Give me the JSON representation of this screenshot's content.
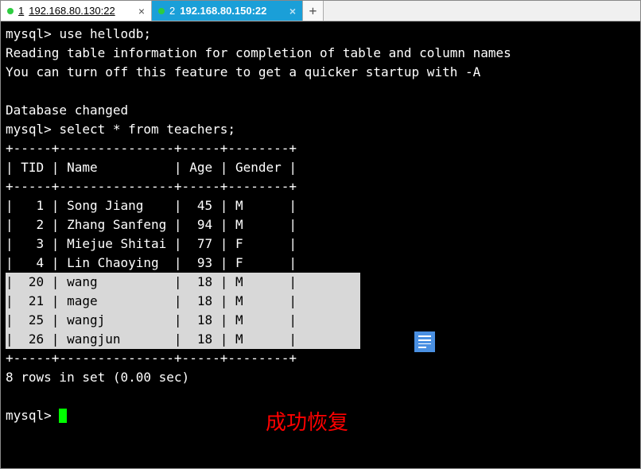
{
  "tabs": [
    {
      "num": "1",
      "title": "192.168.80.130:22",
      "active": false
    },
    {
      "num": "2",
      "title": "192.168.80.150:22",
      "active": true
    }
  ],
  "terminal": {
    "prompt": "mysql>",
    "cmd_use": "use hellodb;",
    "msg_reading": "Reading table information for completion of table and column names",
    "msg_turnoff": "You can turn off this feature to get a quicker startup with -A",
    "msg_dbchanged": "Database changed",
    "cmd_select": "select * from teachers;",
    "border_top": "+-----+---------------+-----+--------+",
    "header_line": "| TID | Name          | Age | Gender |",
    "border_mid": "+-----+---------------+-----+--------+",
    "rows_plain": [
      "|   1 | Song Jiang    |  45 | M      |",
      "|   2 | Zhang Sanfeng |  94 | M      |",
      "|   3 | Miejue Shitai |  77 | F      |",
      "|   4 | Lin Chaoying  |  93 | F      |"
    ],
    "rows_hl": [
      "|  20 | wang          |  18 | M      |",
      "|  21 | mage          |  18 | M      |",
      "|  25 | wangj         |  18 | M      |",
      "|  26 | wangjun       |  18 | M      |"
    ],
    "border_bot": "+-----+---------------+-----+--------+",
    "result_summary": "8 rows in set (0.00 sec)"
  },
  "annotation": "成功恢复",
  "table_data": {
    "columns": [
      "TID",
      "Name",
      "Age",
      "Gender"
    ],
    "rows": [
      {
        "TID": 1,
        "Name": "Song Jiang",
        "Age": 45,
        "Gender": "M",
        "highlighted": false
      },
      {
        "TID": 2,
        "Name": "Zhang Sanfeng",
        "Age": 94,
        "Gender": "M",
        "highlighted": false
      },
      {
        "TID": 3,
        "Name": "Miejue Shitai",
        "Age": 77,
        "Gender": "F",
        "highlighted": false
      },
      {
        "TID": 4,
        "Name": "Lin Chaoying",
        "Age": 93,
        "Gender": "F",
        "highlighted": false
      },
      {
        "TID": 20,
        "Name": "wang",
        "Age": 18,
        "Gender": "M",
        "highlighted": true
      },
      {
        "TID": 21,
        "Name": "mage",
        "Age": 18,
        "Gender": "M",
        "highlighted": true
      },
      {
        "TID": 25,
        "Name": "wangj",
        "Age": 18,
        "Gender": "M",
        "highlighted": true
      },
      {
        "TID": 26,
        "Name": "wangjun",
        "Age": 18,
        "Gender": "M",
        "highlighted": true
      }
    ]
  }
}
